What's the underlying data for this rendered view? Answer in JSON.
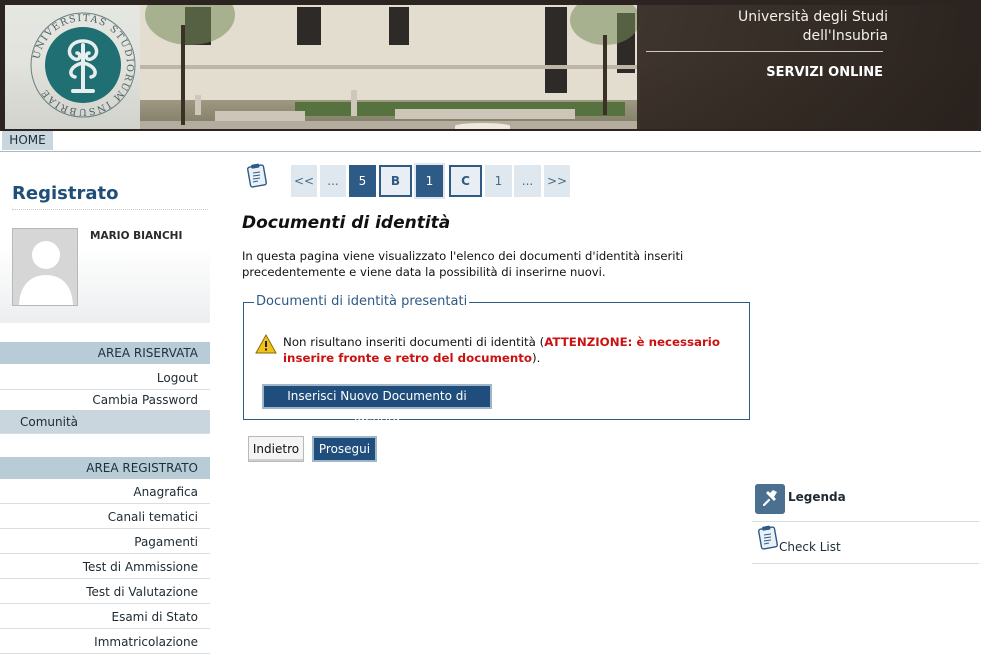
{
  "header": {
    "university_line1": "Università degli Studi",
    "university_line2": "dell'Insubria",
    "services": "SERVIZI ONLINE",
    "seal_text": "UNIVERSITAS STUDIORUM INSUBRIAE"
  },
  "nav": {
    "home": "HOME"
  },
  "sidebar": {
    "title": "Registrato",
    "user_name": "MARIO BIANCHI",
    "area_riservata": {
      "heading": "AREA RISERVATA",
      "items": [
        "Logout",
        "Cambia Password",
        "Comunità"
      ]
    },
    "area_registrato": {
      "heading": "AREA REGISTRATO",
      "items": [
        "Anagrafica",
        "Canali tematici",
        "Pagamenti",
        "Test di Ammissione",
        "Test di Valutazione",
        "Esami di Stato",
        "Immatricolazione"
      ]
    }
  },
  "pager": {
    "items": [
      "<<",
      "...",
      "5",
      "B",
      "1",
      "C",
      "1",
      "...",
      ">>"
    ]
  },
  "main": {
    "title": "Documenti di identità",
    "intro": "In questa pagina viene visualizzato l'elenco dei documenti d'identità inseriti precedentemente e viene data la possibilità di inserirne nuovi.",
    "fieldset_legend": "Documenti di identità presentati",
    "warning_prefix": "Non risultano inseriti documenti di identità (",
    "warning_attention": "ATTENZIONE: è necessario inserire fronte e retro del documento",
    "warning_suffix": ").",
    "insert_button": "Inserisci Nuovo Documento di Identità",
    "back_button": "Indietro",
    "next_button": "Prosegui"
  },
  "right_panel": {
    "legend": "Legenda",
    "checklist": "Check List"
  },
  "colors": {
    "primary": "#1f4e7d",
    "accent_blue": "#2e5a86",
    "section_bg": "#b8ccd8",
    "attention": "#cc1111"
  }
}
